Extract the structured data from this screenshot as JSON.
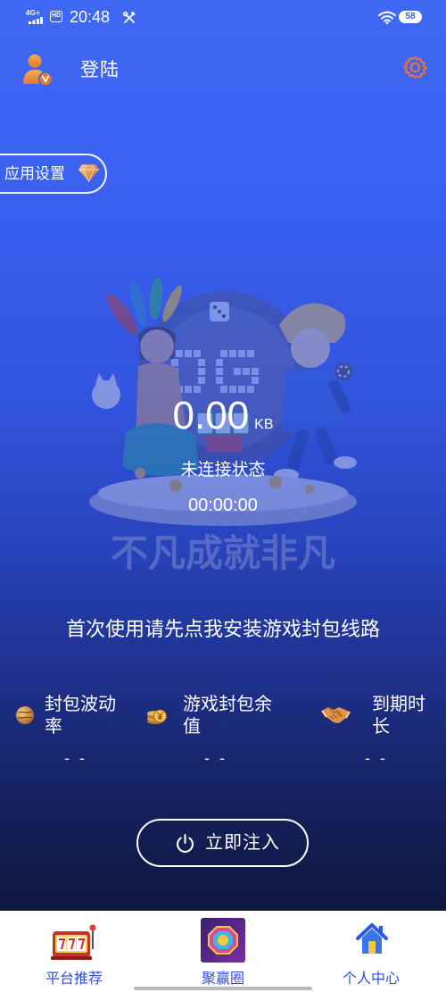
{
  "status_bar": {
    "network": "4G+",
    "hd_badge": "HD",
    "time": "20:48",
    "battery_level": "58",
    "icons": [
      "signal-icon",
      "tools-icon",
      "wifi-icon",
      "battery-icon"
    ]
  },
  "header": {
    "title": "登陆",
    "avatar_icon": "user-vip-avatar-icon",
    "settings_icon": "gear-icon"
  },
  "app_settings": {
    "label": "应用设置",
    "icon": "diamond-vip-icon"
  },
  "artwork": {
    "slogan": "不凡成就非凡"
  },
  "traffic": {
    "amount": "0.00",
    "unit": "KB",
    "connection_status": "未连接状态",
    "elapsed": "00:00:00"
  },
  "install_prompt": "首次使用请先点我安装游戏封包线路",
  "stats": [
    {
      "label": "封包波动率",
      "value": "- -",
      "icon": "globe-coin-icon"
    },
    {
      "label": "游戏封包余值",
      "value": "- -",
      "icon": "coin-stack-icon"
    },
    {
      "label": "到期时长",
      "value": "- -",
      "icon": "handshake-icon"
    }
  ],
  "inject_button": {
    "label": "立即注入",
    "icon": "power-icon"
  },
  "bottom_nav": {
    "items": [
      {
        "label": "平台推荐",
        "icon": "slot-machine-icon"
      },
      {
        "label": "聚赢圈",
        "icon": "game-app-icon"
      },
      {
        "label": "个人中心",
        "icon": "house-icon"
      }
    ]
  },
  "colors": {
    "background_top": "#3f68f4",
    "background_bottom": "#0b1130",
    "accent_orange": "#e8733a",
    "nav_label": "#2f50d8",
    "nav_background": "#ffffff"
  }
}
